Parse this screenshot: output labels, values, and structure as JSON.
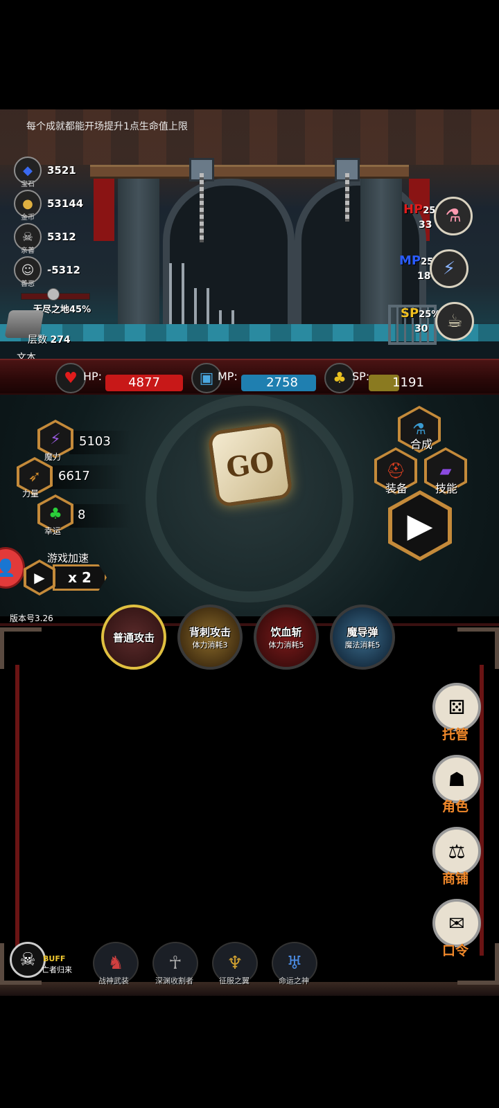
{
  "tip": "每个成就都能开场提升1点生命值上限",
  "resources": [
    {
      "name": "宝石",
      "value": "3521",
      "icon": "gem-icon"
    },
    {
      "name": "金币",
      "value": "53144",
      "icon": "coin-icon"
    },
    {
      "name": "亲善",
      "value": "5312",
      "icon": "skull-icon"
    },
    {
      "name": "善恶",
      "value": "-5312",
      "icon": "mask-icon"
    }
  ],
  "layer": {
    "name": "无尽之地45%",
    "label": "层数",
    "value": "274",
    "text": "文本"
  },
  "potions": {
    "hp": {
      "label": "HP",
      "pct": "25%",
      "count": "33",
      "color": "#e01c1c"
    },
    "mp": {
      "label": "MP",
      "pct": "25%",
      "count": "18",
      "color": "#2a5cff"
    },
    "sp": {
      "label": "SP",
      "pct": "25%",
      "count": "30",
      "color": "#f0c020"
    }
  },
  "status": {
    "hp": {
      "label": "HP:",
      "value": "4877",
      "color": "#c81818"
    },
    "mp": {
      "label": "MP:",
      "value": "2758",
      "color": "#1f7fb0"
    },
    "sp": {
      "label": "SP:",
      "value": "1191",
      "color": "#8a7a20"
    }
  },
  "attributes": [
    {
      "name": "魔力",
      "value": "5103",
      "icon": "magic-icon"
    },
    {
      "name": "力量",
      "value": "6617",
      "icon": "strength-icon"
    },
    {
      "name": "幸运",
      "value": "8",
      "icon": "clover-icon"
    }
  ],
  "dice_label": "GO",
  "menu": {
    "craft": "合成",
    "equip": "装备",
    "skill": "技能"
  },
  "speed": {
    "label": "游戏加速",
    "value": "x 2"
  },
  "version": "版本号3.26",
  "skills": [
    {
      "name": "普通攻击",
      "cost": ""
    },
    {
      "name": "背刺攻击",
      "cost": "体力消耗3"
    },
    {
      "name": "饮血斩",
      "cost": "体力消耗5"
    },
    {
      "name": "魔导弹",
      "cost": "魔法消耗5"
    }
  ],
  "side_buttons": [
    {
      "label": "托管",
      "icon": "dice-icon"
    },
    {
      "label": "角色",
      "icon": "hood-icon"
    },
    {
      "label": "商铺",
      "icon": "shop-icon"
    },
    {
      "label": "口令",
      "icon": "scroll-icon"
    }
  ],
  "buff": {
    "title": "BUFF",
    "name": "亡者归来"
  },
  "equipment": [
    {
      "name": "战神武装"
    },
    {
      "name": "深渊收割者"
    },
    {
      "name": "征服之翼"
    },
    {
      "name": "命运之神"
    }
  ]
}
